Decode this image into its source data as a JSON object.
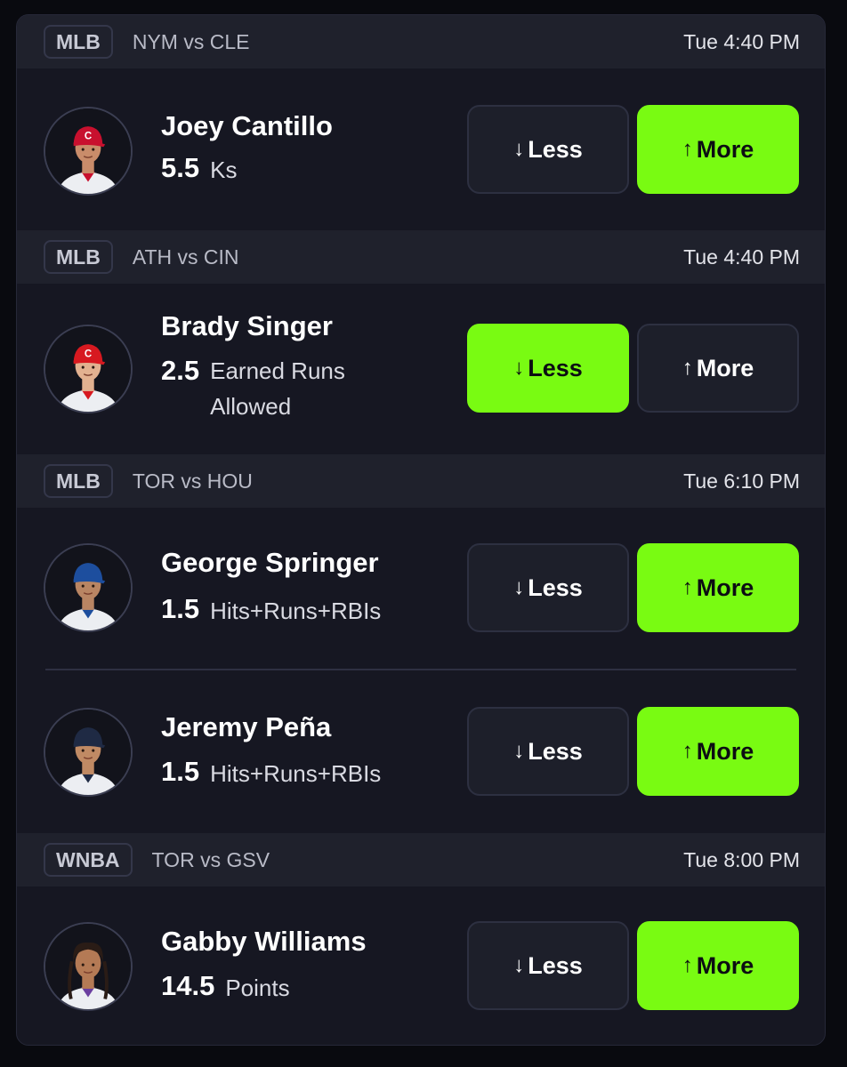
{
  "games": [
    {
      "league": "MLB",
      "matchup": "NYM vs CLE",
      "time": "Tue 4:40 PM",
      "props": [
        {
          "player": "Joey Cantillo",
          "line": "5.5",
          "stat": "Ks",
          "selected": "more",
          "cap_color": "#c8102e",
          "cap_letter": "C",
          "skin": "#c98c6a"
        }
      ]
    },
    {
      "league": "MLB",
      "matchup": "ATH vs CIN",
      "time": "Tue 4:40 PM",
      "props": [
        {
          "player": "Brady Singer",
          "line": "2.5",
          "stat": "Earned Runs Allowed",
          "selected": "less",
          "cap_color": "#d71920",
          "cap_letter": "C",
          "skin": "#e2b190"
        }
      ]
    },
    {
      "league": "MLB",
      "matchup": "TOR vs HOU",
      "time": "Tue 6:10 PM",
      "props": [
        {
          "player": "George Springer",
          "line": "1.5",
          "stat": "Hits+Runs+RBIs",
          "selected": "more",
          "cap_color": "#1d4e9e",
          "cap_letter": "",
          "skin": "#b98563"
        },
        {
          "player": "Jeremy Peña",
          "line": "1.5",
          "stat": "Hits+Runs+RBIs",
          "selected": "more",
          "cap_color": "#1f2a44",
          "cap_letter": "",
          "skin": "#c08a64"
        }
      ]
    },
    {
      "league": "WNBA",
      "matchup": "TOR vs GSV",
      "time": "Tue 8:00 PM",
      "props": [
        {
          "player": "Gabby Williams",
          "line": "14.5",
          "stat": "Points",
          "selected": "more",
          "cap_color": "",
          "cap_letter": "",
          "skin": "#b47a55"
        }
      ]
    }
  ],
  "buttons": {
    "less_label": "Less",
    "more_label": "More",
    "less_arrow": "↓",
    "more_arrow": "↑"
  },
  "colors": {
    "accent": "#79fb12",
    "card_bg": "#161722",
    "header_bg": "#1f212c"
  }
}
